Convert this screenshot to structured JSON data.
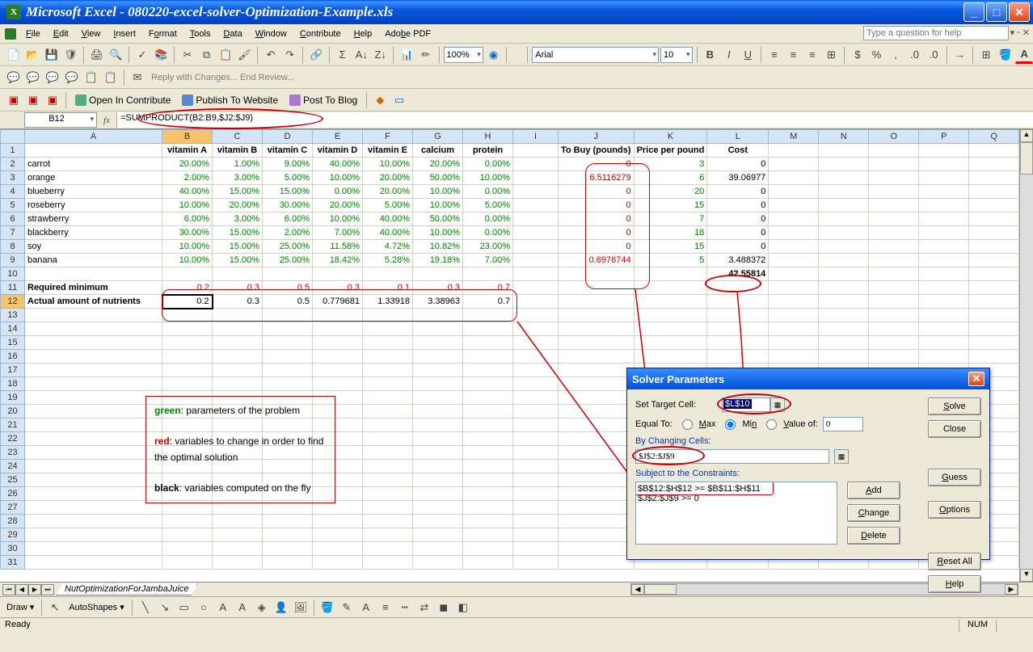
{
  "title": "Microsoft Excel - 080220-excel-solver-Optimization-Example.xls",
  "menus": [
    "File",
    "Edit",
    "View",
    "Insert",
    "Format",
    "Tools",
    "Data",
    "Window",
    "Contribute",
    "Help",
    "Adobe PDF"
  ],
  "helpPlaceholder": "Type a question for help",
  "zoom": "100%",
  "font": "Arial",
  "fontsize": "10",
  "reviewBar": "Reply with Changes...  End Review...",
  "contribute": {
    "open": "Open In Contribute",
    "publish": "Publish To Website",
    "post": "Post To Blog"
  },
  "namebox": "B12",
  "formula": "=SUMPRODUCT(B2:B9,$J2:$J9)",
  "cols": [
    "A",
    "B",
    "C",
    "D",
    "E",
    "F",
    "G",
    "H",
    "I",
    "J",
    "K",
    "L",
    "M",
    "N",
    "O",
    "P",
    "Q"
  ],
  "headerRow": {
    "B": "vitamin A",
    "C": "vitamin B",
    "D": "vitamin C",
    "E": "vitamin D",
    "F": "vitamin E",
    "G": "calcium",
    "H": "protein",
    "J": "To Buy (pounds)",
    "K": "Price per pound",
    "L": "Cost"
  },
  "foods": [
    {
      "name": "carrot",
      "v": [
        "20.00%",
        "1.00%",
        "9.00%",
        "40.00%",
        "10.00%",
        "20.00%",
        "0.00%"
      ],
      "buy": "0",
      "price": "3",
      "cost": "0"
    },
    {
      "name": "orange",
      "v": [
        "2.00%",
        "3.00%",
        "5.00%",
        "10.00%",
        "20.00%",
        "50.00%",
        "10.00%"
      ],
      "buy": "6.5116279",
      "price": "6",
      "cost": "39.06977"
    },
    {
      "name": "blueberry",
      "v": [
        "40.00%",
        "15.00%",
        "15.00%",
        "0.00%",
        "20.00%",
        "10.00%",
        "0.00%"
      ],
      "buy": "0",
      "price": "20",
      "cost": "0"
    },
    {
      "name": "roseberry",
      "v": [
        "10.00%",
        "20.00%",
        "30.00%",
        "20.00%",
        "5.00%",
        "10.00%",
        "5.00%"
      ],
      "buy": "0",
      "price": "15",
      "cost": "0"
    },
    {
      "name": "strawberry",
      "v": [
        "6.00%",
        "3.00%",
        "6.00%",
        "10.00%",
        "40.00%",
        "50.00%",
        "0.00%"
      ],
      "buy": "0",
      "price": "7",
      "cost": "0"
    },
    {
      "name": "blackberry",
      "v": [
        "30.00%",
        "15.00%",
        "2.00%",
        "7.00%",
        "40.00%",
        "10.00%",
        "0.00%"
      ],
      "buy": "0",
      "price": "18",
      "cost": "0"
    },
    {
      "name": "soy",
      "v": [
        "10.00%",
        "15.00%",
        "25.00%",
        "11.58%",
        "4.72%",
        "10.82%",
        "23.00%"
      ],
      "buy": "0",
      "price": "15",
      "cost": "0"
    },
    {
      "name": "banana",
      "v": [
        "10.00%",
        "15.00%",
        "25.00%",
        "18.42%",
        "5.28%",
        "19.18%",
        "7.00%"
      ],
      "buy": "0.6976744",
      "price": "5",
      "cost": "3.488372"
    }
  ],
  "total": "42.55814",
  "reqmin": {
    "label": "Required minimum",
    "v": [
      "0.2",
      "0.3",
      "0.5",
      "0.3",
      "0.1",
      "0.3",
      "0.7"
    ]
  },
  "actual": {
    "label": "Actual amount of nutrients",
    "v": [
      "0.2",
      "0.3",
      "0.5",
      "0.779681",
      "1.33918",
      "3.38963",
      "0.7"
    ]
  },
  "legend": {
    "l1a": "green",
    "l1b": ": parameters of the problem",
    "l2a": "red",
    "l2b": ": variables to change in order to find the optimal solution",
    "l3a": "black",
    "l3b": ": variables computed on the fly"
  },
  "sheettab": "NutOptimizationForJambaJuice",
  "draw": {
    "label": "Draw",
    "auto": "AutoShapes"
  },
  "status": {
    "ready": "Ready",
    "num": "NUM"
  },
  "solver": {
    "title": "Solver Parameters",
    "setTarget": "Set Target Cell:",
    "targetVal": "$L$10",
    "equalTo": "Equal To:",
    "max": "Max",
    "min": "Min",
    "valueOf": "Value of:",
    "valueNum": "0",
    "byChanging": "By Changing Cells:",
    "changingVal": "$J$2:$J$9",
    "subject": "Subject to the Constraints:",
    "c1": "$B$12:$H$12 >= $B$11:$H$11",
    "c2": "$J$2:$J$9 >= 0",
    "btns": {
      "solve": "Solve",
      "close": "Close",
      "guess": "Guess",
      "options": "Options",
      "resetAll": "Reset All",
      "help": "Help",
      "add": "Add",
      "change": "Change",
      "delete": "Delete"
    }
  }
}
